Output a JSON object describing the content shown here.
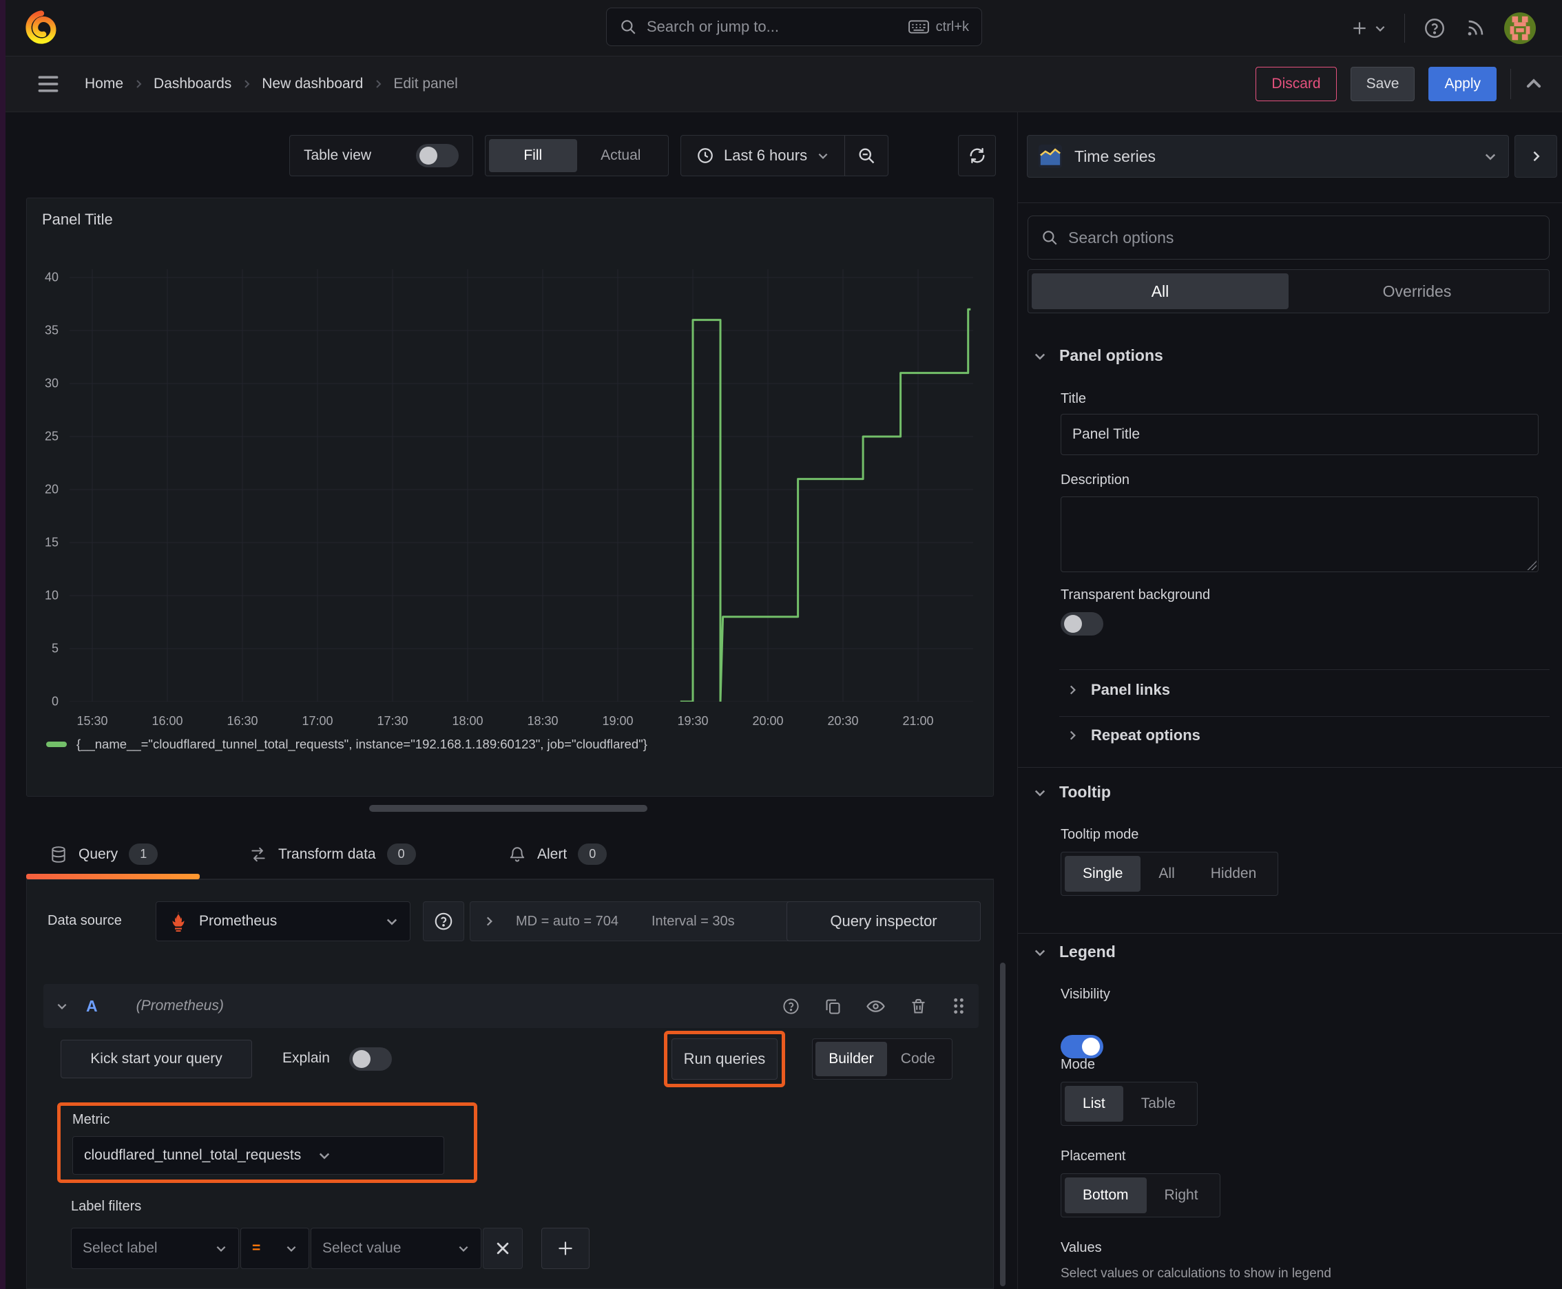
{
  "app": {
    "search_placeholder": "Search or jump to...",
    "search_shortcut": "ctrl+k",
    "breadcrumbs": [
      "Home",
      "Dashboards",
      "New dashboard",
      "Edit panel"
    ],
    "actions": {
      "discard": "Discard",
      "save": "Save",
      "apply": "Apply"
    }
  },
  "toolbar": {
    "table_view_label": "Table view",
    "fill_label": "Fill",
    "actual_label": "Actual",
    "time_range": "Last 6 hours"
  },
  "panel": {
    "title": "Panel Title"
  },
  "chart_data": {
    "type": "line",
    "title": "Panel Title",
    "line_style": "step-after",
    "x_ticks": [
      "15:30",
      "16:00",
      "16:30",
      "17:00",
      "17:30",
      "18:00",
      "18:30",
      "19:00",
      "19:30",
      "20:00",
      "20:30",
      "21:00"
    ],
    "y_ticks": [
      40,
      35,
      30,
      25,
      20,
      15,
      10,
      5,
      0
    ],
    "ylim": [
      0,
      40.8
    ],
    "x_range_hours": [
      15.35,
      21.37
    ],
    "grid": true,
    "legend_position": "bottom",
    "series": [
      {
        "name": "{__name__=\"cloudflared_tunnel_total_requests\", instance=\"192.168.1.189:60123\", job=\"cloudflared\"}",
        "color": "#73bf69",
        "points": [
          [
            "19:25",
            0
          ],
          [
            "19:30",
            0
          ],
          [
            "19:30",
            36
          ],
          [
            "19:41",
            36
          ],
          [
            "19:41",
            0
          ],
          [
            "19:42",
            8
          ],
          [
            "20:12",
            8
          ],
          [
            "20:12",
            21
          ],
          [
            "20:38",
            21
          ],
          [
            "20:38",
            25
          ],
          [
            "20:53",
            25
          ],
          [
            "20:53",
            31
          ],
          [
            "21:20",
            31
          ],
          [
            "21:20",
            37
          ],
          [
            "21:21",
            37
          ]
        ]
      }
    ]
  },
  "query_section": {
    "tabs": [
      {
        "label": "Query",
        "count": "1"
      },
      {
        "label": "Transform data",
        "count": "0"
      },
      {
        "label": "Alert",
        "count": "0"
      }
    ],
    "datasource_label": "Data source",
    "datasource_value": "Prometheus",
    "stats_md": "MD = auto = 704",
    "stats_interval": "Interval = 30s",
    "query_inspector_label": "Query inspector",
    "row_ref": "A",
    "row_ds_hint": "(Prometheus)",
    "kick_start_label": "Kick start your query",
    "explain_label": "Explain",
    "run_queries_label": "Run queries",
    "builder_label": "Builder",
    "code_label": "Code",
    "metric_label": "Metric",
    "metric_value": "cloudflared_tunnel_total_requests",
    "label_filters_label": "Label filters",
    "select_label_placeholder": "Select label",
    "operator_value": "=",
    "select_value_placeholder": "Select value"
  },
  "options_pane": {
    "viz_name": "Time series",
    "search_placeholder": "Search options",
    "tab_all": "All",
    "tab_overrides": "Overrides",
    "panel_options": {
      "heading": "Panel options",
      "title_label": "Title",
      "title_value": "Panel Title",
      "description_label": "Description",
      "transparent_label": "Transparent background"
    },
    "panel_links_label": "Panel links",
    "repeat_options_label": "Repeat options",
    "tooltip": {
      "heading": "Tooltip",
      "mode_label": "Tooltip mode",
      "modes": [
        "Single",
        "All",
        "Hidden"
      ],
      "selected": "Single"
    },
    "legend": {
      "heading": "Legend",
      "visibility_label": "Visibility",
      "mode_label": "Mode",
      "modes": [
        "List",
        "Table"
      ],
      "selected_mode": "List",
      "placement_label": "Placement",
      "placements": [
        "Bottom",
        "Right"
      ],
      "selected_placement": "Bottom",
      "values_label": "Values",
      "values_hint": "Select values or calculations to show in legend"
    }
  },
  "colors": {
    "accent_orange": "#ea5b1f",
    "tab_underline": "#ff780a",
    "series_green": "#73bf69",
    "primary_blue": "#3d71d9",
    "danger_pink": "#e5517e"
  }
}
